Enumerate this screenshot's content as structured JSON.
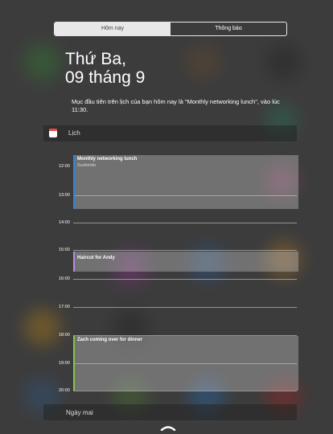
{
  "tabs": [
    {
      "label": "Hôm nay",
      "active": true
    },
    {
      "label": "Thông báo",
      "active": false
    }
  ],
  "header": {
    "weekday": "Thứ Ba,",
    "date": "09 tháng 9",
    "summary": "Mục đầu tiên trên lịch của bạn hôm nay là \"Monthly networking lunch\", vào lúc 11:30."
  },
  "calendar": {
    "label": "Lịch",
    "icon": "calendar-icon",
    "hours": [
      "12:00",
      "13:00",
      "14:00",
      "15:00",
      "16:00",
      "17:00",
      "18:00",
      "19:00",
      "20:00"
    ],
    "events": [
      {
        "title": "Monthly networking lunch",
        "location": "Sushirrito",
        "color": "#2e86de"
      },
      {
        "title": "Haircut for Andy",
        "location": "",
        "color": "#b78be0"
      },
      {
        "title": "Zach coming over for dinner",
        "location": "",
        "color": "#8bc34a"
      }
    ]
  },
  "tomorrow": {
    "label": "Ngày mai"
  },
  "grabber": {
    "icon": "chevron-up-icon"
  }
}
